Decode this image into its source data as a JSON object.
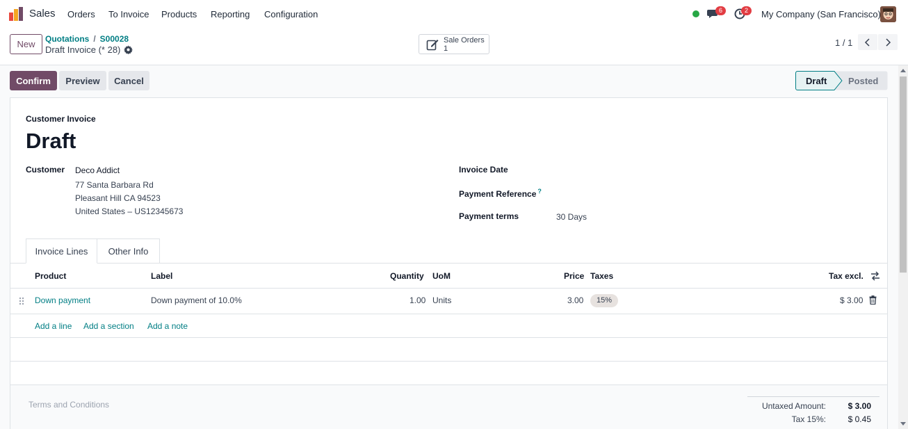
{
  "navbar": {
    "app_name": "Sales",
    "menu": [
      "Orders",
      "To Invoice",
      "Products",
      "Reporting",
      "Configuration"
    ],
    "messages_count": "6",
    "activities_count": "2",
    "company": "My Company (San Francisco)"
  },
  "control_panel": {
    "new_label": "New",
    "breadcrumb": [
      "Quotations",
      "S00028"
    ],
    "breadcrumb_sep": "/",
    "record_title": "Draft Invoice (* 28)",
    "smart_button": {
      "label": "Sale Orders",
      "count": "1"
    },
    "pager": "1 / 1"
  },
  "actions": {
    "confirm": "Confirm",
    "preview": "Preview",
    "cancel": "Cancel"
  },
  "statusbar": {
    "states": [
      "Draft",
      "Posted"
    ],
    "active": "Draft"
  },
  "form": {
    "doc_type": "Customer Invoice",
    "doc_name": "Draft",
    "customer_label": "Customer",
    "customer_name": "Deco Addict",
    "customer_address": [
      "77 Santa Barbara Rd",
      "Pleasant Hill CA 94523",
      "United States – US12345673"
    ],
    "invoice_date_label": "Invoice Date",
    "payment_reference_label": "Payment Reference",
    "help_mark": "?",
    "payment_terms_label": "Payment terms",
    "payment_terms_value": "30 Days"
  },
  "tabs": [
    "Invoice Lines",
    "Other Info"
  ],
  "table": {
    "headers": {
      "product": "Product",
      "label": "Label",
      "quantity": "Quantity",
      "uom": "UoM",
      "price": "Price",
      "taxes": "Taxes",
      "tax_excl": "Tax excl."
    },
    "rows": [
      {
        "product": "Down payment",
        "label": "Down payment of 10.0%",
        "quantity": "1.00",
        "uom": "Units",
        "price": "3.00",
        "taxes": "15%",
        "subtotal": "$ 3.00"
      }
    ],
    "add_links": [
      "Add a line",
      "Add a section",
      "Add a note"
    ]
  },
  "footer": {
    "terms_placeholder": "Terms and Conditions",
    "untaxed_label": "Untaxed Amount:",
    "untaxed_value": "$ 3.00",
    "tax_label": "Tax 15%:",
    "tax_value": "$ 0.45"
  },
  "colors": {
    "primary": "#714b67",
    "link": "#017e84",
    "badge": "#e23d43",
    "online": "#28a745"
  }
}
